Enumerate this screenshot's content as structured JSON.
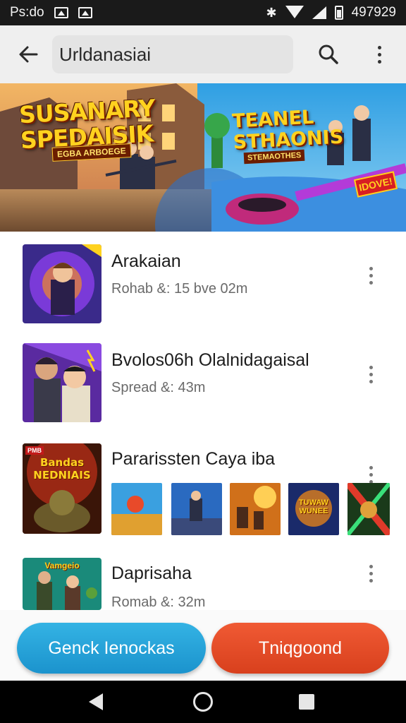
{
  "status_bar": {
    "left_text": "Ps:do",
    "right_text": "497929",
    "icons": [
      "image-icon",
      "image-icon",
      "bluetooth-icon",
      "wifi-icon",
      "signal-icon",
      "battery-icon"
    ]
  },
  "app_bar": {
    "search_value": "Urldanasiai",
    "icons": [
      "back-arrow-icon",
      "search-icon",
      "more-vertical-icon"
    ]
  },
  "banner": {
    "left_title": "SUSANARY\nSPEDAISIK",
    "left_tag": "EGBA ARBOEGE",
    "right_title": "TEANEL\nSTHAONIS",
    "right_tag": "STEMAOTHES",
    "badge": "IDOVE!",
    "page_count": 4,
    "active_page": 1
  },
  "list": {
    "items": [
      {
        "title": "Arakaian",
        "meta": "Rohab &: 15 bve 02m"
      },
      {
        "title": "Bvolos06h Olalnidagaisal",
        "meta": "Spread &: 43m"
      },
      {
        "title": "Pararissten Caya iba",
        "meta": "",
        "thumb_text": "Bandas\nNEDNIAIS",
        "thumb_corner": "PMB",
        "screenshots": [
          "shot-1",
          "shot-2",
          "shot-3",
          "shot-4",
          "shot-5"
        ],
        "screenshot_texts": [
          "",
          "",
          "",
          "TUWAW\nWUNEE",
          ""
        ]
      },
      {
        "title": "Daprisaha",
        "meta": "Romab &: 32m",
        "thumb_text": "Vamgeio"
      }
    ]
  },
  "bottom_actions": {
    "left_label": "Genck Ienockas",
    "right_label": "Tniqgoond",
    "left_color": "#23a6dc",
    "right_color": "#e94b28"
  },
  "colors": {
    "app_bar_bg": "#efefef",
    "accent_blue": "#1e7be6",
    "status_bar_bg": "#1a1a1a",
    "nav_bar_bg": "#000000"
  }
}
